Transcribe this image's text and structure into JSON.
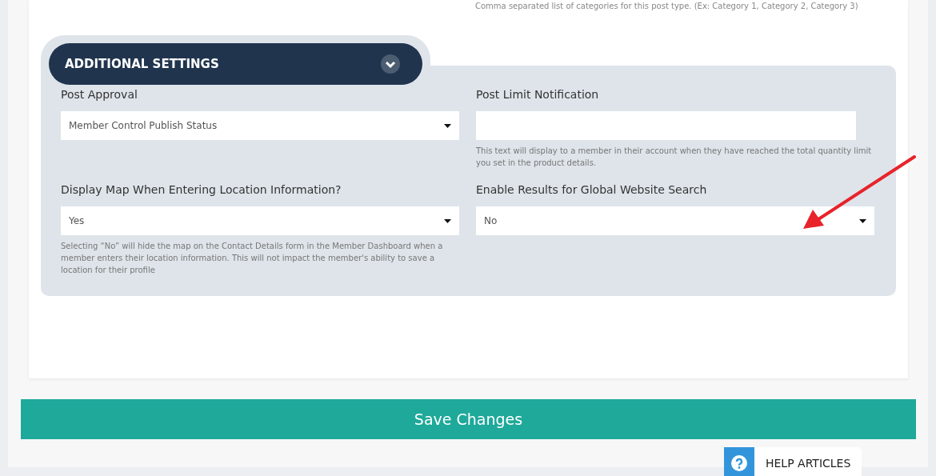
{
  "top_hint": "Comma separated list of categories for this post type. (Ex: Category 1, Category 2, Category 3)",
  "section": {
    "title": "ADDITIONAL SETTINGS",
    "expanded": true,
    "fields": [
      {
        "kind": "select",
        "label": "Post Approval",
        "value": "Member Control Publish Status"
      },
      {
        "kind": "text",
        "label": "Post Limit Notification",
        "hint": "This text will display to a member in their account when they have reached the total quantity limit you set in the product details."
      },
      {
        "kind": "select",
        "label": "Display Map When Entering Location Information?",
        "value": "Yes",
        "hint": "Selecting “No” will hide the map on the Contact Details form in the Member Dashboard when a member enters their location information. This will not impact the member's ability to save a location for their profile"
      },
      {
        "kind": "select",
        "label": "Enable Results for Global Website Search",
        "value": "No"
      }
    ]
  },
  "save_button": "Save Changes",
  "help_button": "HELP ARTICLES"
}
